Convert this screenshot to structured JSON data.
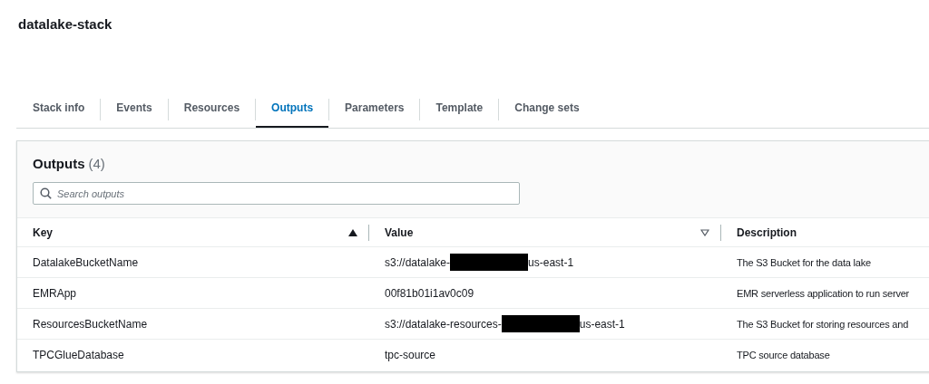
{
  "page_title": "datalake-stack",
  "tabs": [
    {
      "label": "Stack info",
      "selected": false
    },
    {
      "label": "Events",
      "selected": false
    },
    {
      "label": "Resources",
      "selected": false
    },
    {
      "label": "Outputs",
      "selected": true
    },
    {
      "label": "Parameters",
      "selected": false
    },
    {
      "label": "Template",
      "selected": false
    },
    {
      "label": "Change sets",
      "selected": false
    }
  ],
  "panel": {
    "title": "Outputs",
    "count": "(4)"
  },
  "search": {
    "placeholder": "Search outputs"
  },
  "table": {
    "columns": [
      {
        "label": "Key",
        "sortable": true,
        "sorted": true
      },
      {
        "label": "Value",
        "sortable": true,
        "sorted": false
      },
      {
        "label": "Description",
        "sortable": false
      }
    ],
    "rows": [
      {
        "key": "DatalakeBucketName",
        "value": "s3://datalake-",
        "redacted": true,
        "value_suffix": "us-east-1",
        "description": "The S3 Bucket for the data lake"
      },
      {
        "key": "EMRApp",
        "value": "00f81b01i1av0c09",
        "redacted": false,
        "description": "EMR serverless application to run server"
      },
      {
        "key": "ResourcesBucketName",
        "value": "s3://datalake-resources-",
        "redacted": true,
        "value_suffix": "us-east-1",
        "description": "The S3 Bucket for storing resources and"
      },
      {
        "key": "TPCGlueDatabase",
        "value": "tpc-source",
        "redacted": false,
        "description": "TPC source database"
      }
    ]
  }
}
